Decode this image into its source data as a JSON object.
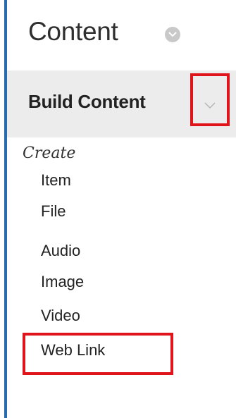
{
  "header": {
    "title": "Content"
  },
  "build_content": {
    "label": "Build Content"
  },
  "menu": {
    "section_heading": "Create",
    "items": [
      {
        "label": "Item"
      },
      {
        "label": "File"
      },
      {
        "label": "Audio"
      },
      {
        "label": "Image"
      },
      {
        "label": "Video"
      },
      {
        "label": "Web Link"
      }
    ]
  },
  "colors": {
    "border_accent": "#2a6ab0",
    "highlight": "#e0141b",
    "bar_background": "#ececec"
  },
  "icons": {
    "title_chevron": "chevron-down-icon",
    "build_chevron": "chevron-down-icon"
  }
}
